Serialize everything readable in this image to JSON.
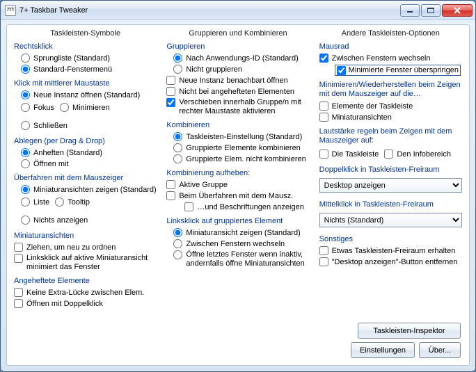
{
  "window": {
    "icon_text": "7TT",
    "title": "7+ Taskbar Tweaker"
  },
  "columns": {
    "col1": {
      "header": "Taskleisten-Symbole",
      "rightclick": {
        "title": "Rechtsklick",
        "jumplist": "Sprungliste (Standard)",
        "stdmenu": "Standard-Fenstermenü"
      },
      "middleclick": {
        "title": "Klick mit mittlerer Maustaste",
        "newinst": "Neue Instanz öffnen (Standard)",
        "focus": "Fokus",
        "minimize": "Minimieren",
        "close": "Schließen"
      },
      "drop": {
        "title": "Ablegen (per Drag & Drop)",
        "pin": "Anheften (Standard)",
        "openwith": "Öffnen mit"
      },
      "hover": {
        "title": "Überfahren mit dem Mauszeiger",
        "thumbs": "Miniaturansichten zeigen (Standard)",
        "list": "Liste",
        "tooltip": "Tooltip",
        "nothing": "Nichts anzeigen"
      },
      "thumbs": {
        "title": "Miniaturansichten",
        "drag": "Ziehen, um neu zu ordnen",
        "leftmin": "Linksklick auf aktive Miniaturansicht minimiert das Fenster"
      },
      "pinned": {
        "title": "Angeheftete Elemente",
        "nogap": "Keine Extra-Lücke zwischen Elem.",
        "dblclick": "Öffnen mit Doppelklick"
      }
    },
    "col2": {
      "header": "Gruppieren und Kombinieren",
      "group": {
        "title": "Gruppieren",
        "byapp": "Nach Anwendungs-ID (Standard)",
        "none": "Nicht gruppieren",
        "adjacent": "Neue Instanz benachbart öffnen",
        "notpinned": "Nicht bei angehefteten Elementen",
        "rightdrag": "Verschieben innerhalb Gruppe/n mit rechter Maustaste aktivieren"
      },
      "combine": {
        "title": "Kombinieren",
        "taskbar": "Taskleisten-Einstellung (Standard)",
        "grouped": "Gruppierte Elemente kombinieren",
        "never": "Gruppierte Elem. nicht kombinieren"
      },
      "decombine": {
        "title": "Kombinierung aufheben:",
        "active": "Aktive Gruppe",
        "hover": "Beim Überfahren mit dem Mausz.",
        "labels": "…und Beschriftungen anzeigen"
      },
      "leftclick": {
        "title": "Linksklick auf gruppiertes Element",
        "thumb": "Miniaturansicht zeigen (Standard)",
        "cycle": "Zwischen Fenstern wechseln",
        "last": "Öffne letztes Fenster wenn inaktiv, andernfalls öffne Miniaturansichten"
      }
    },
    "col3": {
      "header": "Andere Taskleisten-Optionen",
      "wheel": {
        "title": "Mausrad",
        "cycle": "Zwischen Fenstern wechseln",
        "skipmin": "Minimierte Fenster überspringen"
      },
      "minrestore": {
        "title": "Minimieren/Wiederherstellen beim Zeigen mit dem Mauszeiger auf die…",
        "tbitems": "Elemente der Taskleiste",
        "thumbs": "Miniaturansichten"
      },
      "volume": {
        "title": "Lautstärke regeln beim Zeigen mit dem Mauszeiger auf:",
        "taskbar": "Die Taskleiste",
        "tray": "Den Infobereich"
      },
      "dblclick": {
        "title": "Doppelklick in Taskleisten-Freiraum",
        "value": "Desktop anzeigen"
      },
      "midclick": {
        "title": "Mittelklick in Taskleisten-Freiraum",
        "value": "Nichts (Standard)"
      },
      "other": {
        "title": "Sonstiges",
        "reserve": "Etwas Taskleisten-Freiraum erhalten",
        "hidedesktop": "\"Desktop anzeigen\"-Button entfernen"
      }
    }
  },
  "buttons": {
    "inspector": "Taskleisten-Inspektor",
    "settings": "Einstellungen",
    "about": "Über..."
  }
}
